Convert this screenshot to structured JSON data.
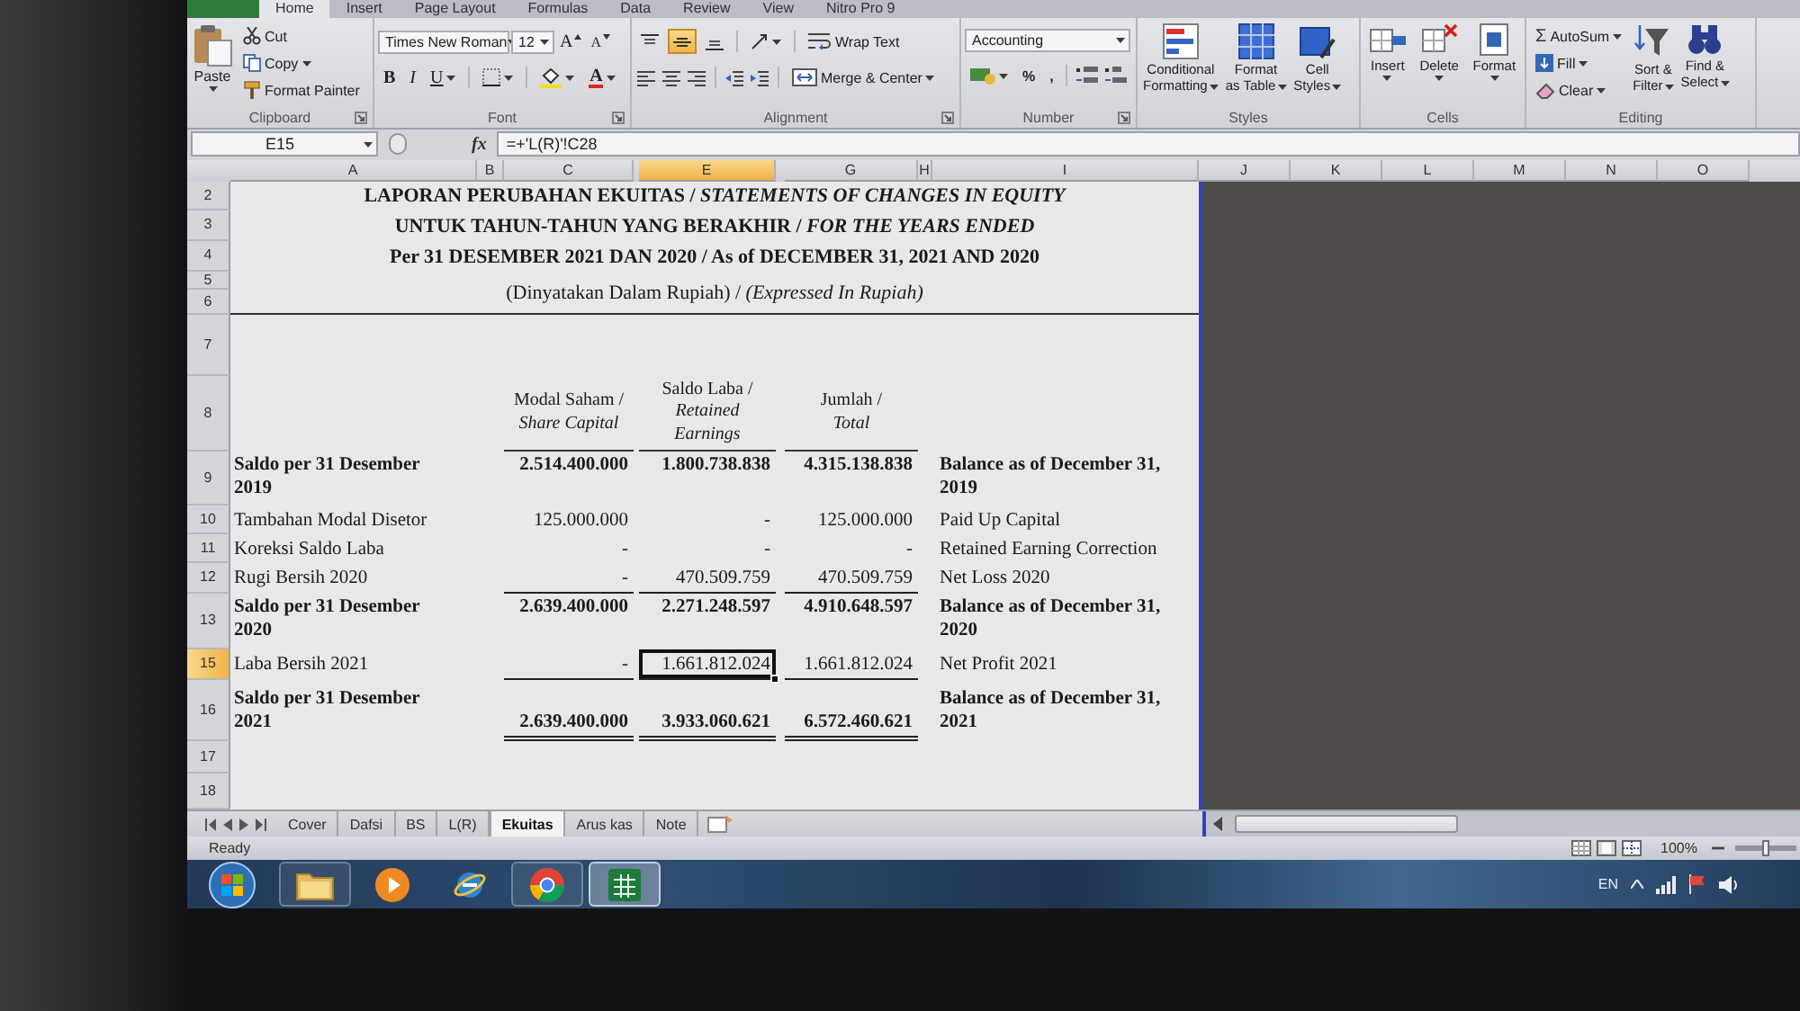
{
  "ribbon_tabs": [
    {
      "label": "Home",
      "selected": true
    },
    {
      "label": "Insert",
      "selected": false
    },
    {
      "label": "Page Layout",
      "selected": false
    },
    {
      "label": "Formulas",
      "selected": false
    },
    {
      "label": "Data",
      "selected": false
    },
    {
      "label": "Review",
      "selected": false
    },
    {
      "label": "View",
      "selected": false
    },
    {
      "label": "Nitro Pro 9",
      "selected": false
    }
  ],
  "clipboard": {
    "paste": "Paste",
    "cut": "Cut",
    "copy": "Copy",
    "format_painter": "Format Painter",
    "label": "Clipboard"
  },
  "font": {
    "name": "Times New Roman",
    "size": "12",
    "grow": "A",
    "shrink": "A",
    "bold": "B",
    "italic": "I",
    "underline": "U",
    "font_color": "A",
    "label": "Font"
  },
  "alignment": {
    "vertical_align": [
      {
        "selected": false
      },
      {
        "selected": true
      },
      {
        "selected": false
      }
    ],
    "wrap_text": "Wrap Text",
    "merge_center": "Merge & Center",
    "label": "Alignment"
  },
  "number": {
    "format": "Accounting",
    "percent": "%",
    "comma": ",",
    "label": "Number"
  },
  "styles": {
    "buttons": [
      "Conditional\nFormatting",
      "Format\nas Table",
      "Cell\nStyles"
    ],
    "label": "Styles"
  },
  "cells": {
    "buttons": [
      "Insert",
      "Delete",
      "Format"
    ],
    "label": "Cells"
  },
  "editing": {
    "autosum_symbol": "Σ",
    "autosum": "AutoSum",
    "fill": "Fill",
    "clear": "Clear",
    "sort_filter": "Sort &\nFilter",
    "find_select": "Find &\nSelect",
    "label": "Editing"
  },
  "formula_bar": {
    "name_box": "E15",
    "function_button": "fx",
    "formula": "=+'L(R)'!C28"
  },
  "columns": [
    {
      "label": "A",
      "selected": false
    },
    {
      "label": "B",
      "selected": false
    },
    {
      "label": "C",
      "selected": false
    },
    {
      "label": "E",
      "selected": true
    },
    {
      "label": "G",
      "selected": false
    },
    {
      "label": "H",
      "selected": false
    },
    {
      "label": "I",
      "selected": false
    },
    {
      "label": "J",
      "selected": false
    },
    {
      "label": "K",
      "selected": false
    },
    {
      "label": "L",
      "selected": false
    },
    {
      "label": "M",
      "selected": false
    },
    {
      "label": "N",
      "selected": false
    },
    {
      "label": "O",
      "selected": false
    }
  ],
  "rows": [
    {
      "label": "2",
      "selected": false
    },
    {
      "label": "3",
      "selected": false
    },
    {
      "label": "4",
      "selected": false
    },
    {
      "label": "5",
      "selected": false
    },
    {
      "label": "6",
      "selected": false
    },
    {
      "label": "7",
      "selected": false
    },
    {
      "label": "8",
      "selected": false
    },
    {
      "label": "9",
      "selected": false
    },
    {
      "label": "10",
      "selected": false
    },
    {
      "label": "11",
      "selected": false
    },
    {
      "label": "12",
      "selected": false
    },
    {
      "label": "13",
      "selected": false
    },
    {
      "label": "15",
      "selected": true
    },
    {
      "label": "16",
      "selected": false
    },
    {
      "label": "17",
      "selected": false
    },
    {
      "label": "18",
      "selected": false
    }
  ],
  "report": {
    "title": [
      {
        "text": "LAPORAN PERUBAHAN EKUITAS / *STATEMENTS OF CHANGES IN EQUITY*",
        "bold": true
      },
      {
        "text": "UNTUK TAHUN-TAHUN YANG BERAKHIR / *FOR THE YEARS ENDED*",
        "bold": true
      },
      {
        "text": "Per 31 DESEMBER 2021 DAN 2020 / As of DECEMBER 31, 2021 AND 2020",
        "bold": true
      },
      {
        "text": "(Dinyatakan Dalam Rupiah) / *(Expressed In Rupiah)*",
        "bold": false
      }
    ],
    "headings": [
      "Modal Saham /\n*Share Capital*",
      "Saldo Laba /\n*Retained*\n*Earnings*",
      "Jumlah /\n*Total*"
    ],
    "rows": [
      {
        "kind": "balance",
        "underlined": false,
        "cells": [
          {
            "text": "Saldo per 31 Desember\n2019",
            "selected": false
          },
          {
            "text": "2.514.400.000",
            "selected": false
          },
          {
            "text": "1.800.738.838",
            "selected": false
          },
          {
            "text": "4.315.138.838",
            "selected": false
          },
          {
            "text": "Balance as of December 31,\n2019",
            "selected": false
          }
        ]
      },
      {
        "kind": "movement",
        "underlined": false,
        "cells": [
          {
            "text": "Tambahan Modal Disetor",
            "selected": false
          },
          {
            "text": "125.000.000",
            "selected": false
          },
          {
            "text": "-",
            "selected": false
          },
          {
            "text": "125.000.000",
            "selected": false
          },
          {
            "text": "Paid Up Capital",
            "selected": false
          }
        ]
      },
      {
        "kind": "movement",
        "underlined": false,
        "cells": [
          {
            "text": "Koreksi Saldo Laba",
            "selected": false
          },
          {
            "text": "-",
            "selected": false
          },
          {
            "text": "-",
            "selected": false
          },
          {
            "text": "-",
            "selected": false
          },
          {
            "text": "Retained Earning Correction",
            "selected": false
          }
        ]
      },
      {
        "kind": "movement",
        "underlined": true,
        "cells": [
          {
            "text": "Rugi Bersih 2020",
            "selected": false
          },
          {
            "text": "-",
            "selected": false
          },
          {
            "text": "470.509.759",
            "selected": false
          },
          {
            "text": "470.509.759",
            "selected": false
          },
          {
            "text": "Net Loss 2020",
            "selected": false
          }
        ]
      },
      {
        "kind": "balance",
        "underlined": false,
        "cells": [
          {
            "text": "Saldo per 31 Desember\n2020",
            "selected": false
          },
          {
            "text": "2.639.400.000",
            "selected": false
          },
          {
            "text": "2.271.248.597",
            "selected": false
          },
          {
            "text": "4.910.648.597",
            "selected": false
          },
          {
            "text": "Balance as of December 31,\n2020",
            "selected": false
          }
        ]
      },
      {
        "kind": "movement",
        "underlined": true,
        "cells": [
          {
            "text": "Laba Bersih 2021",
            "selected": false
          },
          {
            "text": "-",
            "selected": false
          },
          {
            "text": "1.661.812.024",
            "selected": true
          },
          {
            "text": "1.661.812.024",
            "selected": false
          },
          {
            "text": "Net Profit 2021",
            "selected": false
          }
        ]
      },
      {
        "kind": "final",
        "underlined": true,
        "cells": [
          {
            "text": "Saldo per 31 Desember\n2021",
            "selected": false
          },
          {
            "text": "2.639.400.000",
            "selected": false
          },
          {
            "text": "3.933.060.621",
            "selected": false
          },
          {
            "text": "6.572.460.621",
            "selected": false
          },
          {
            "text": "Balance as of December 31,\n2021",
            "selected": false
          }
        ]
      }
    ]
  },
  "sheet_tabs": [
    {
      "label": "Cover",
      "selected": false
    },
    {
      "label": "Dafsi",
      "selected": false
    },
    {
      "label": "BS",
      "selected": false
    },
    {
      "label": "L(R)",
      "selected": false
    },
    {
      "label": "Ekuitas",
      "selected": true
    },
    {
      "label": "Arus kas",
      "selected": false
    },
    {
      "label": "Note",
      "selected": false
    }
  ],
  "status_bar": {
    "mode": "Ready",
    "zoom": {
      "label": "100%",
      "level": 0.5
    }
  },
  "taskbar": {
    "apps": [
      {
        "running": true,
        "selected": false
      },
      {
        "running": false,
        "selected": false
      },
      {
        "running": false,
        "selected": false
      },
      {
        "running": true,
        "selected": false
      },
      {
        "running": true,
        "selected": true
      }
    ],
    "language": "EN"
  }
}
